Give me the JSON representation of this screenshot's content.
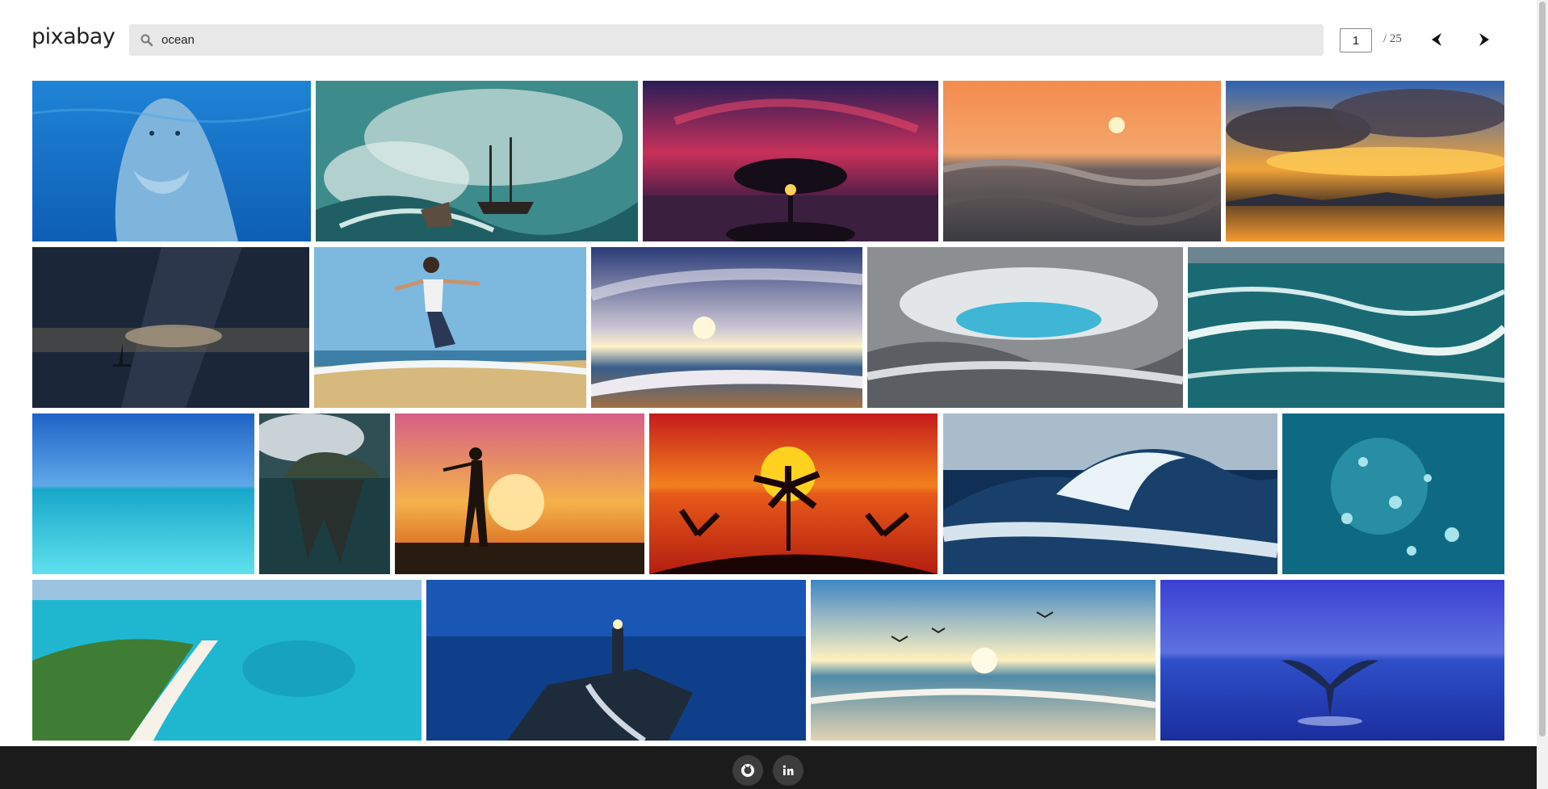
{
  "app": {
    "logo": "pixabay"
  },
  "search": {
    "value": "ocean"
  },
  "pagination": {
    "current": "1",
    "total": "/ 25"
  },
  "gallery": {
    "images": [
      "dolphin",
      "ship-in-storm",
      "tree-red-sky",
      "sun-over-waves",
      "golden-clouds-sunset",
      "sailboat-milky-way",
      "woman-jumping-beach",
      "beach-sunrise",
      "grey-crashing-wave",
      "teal-waves",
      "turquoise-sea",
      "rock-island-reflection",
      "silhouette-woman-sunset",
      "palm-sunset",
      "big-wave",
      "underwater-bubbles",
      "tropical-sandbar",
      "lighthouse-blue",
      "seagulls-beach",
      "whale-tail"
    ]
  },
  "footer": {
    "links": [
      "github",
      "linkedin"
    ]
  }
}
